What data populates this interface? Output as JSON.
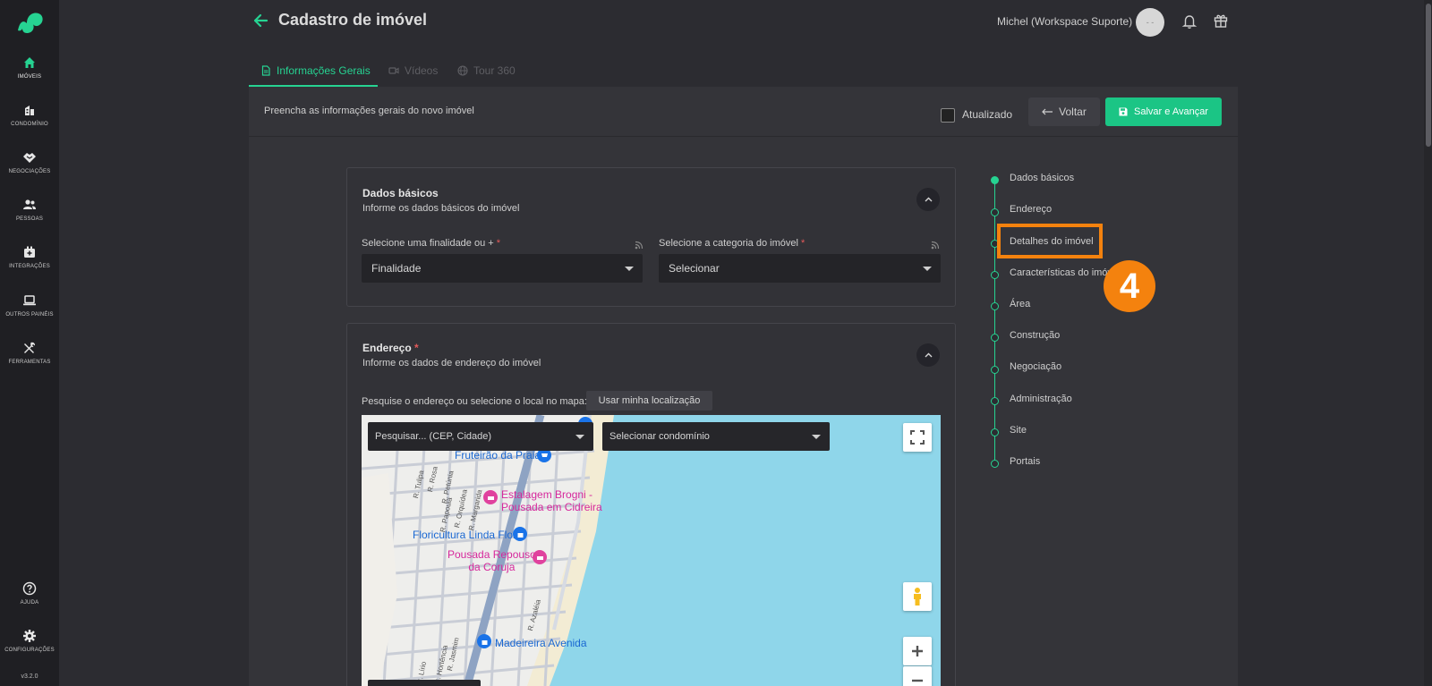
{
  "sidebar": {
    "items": [
      {
        "label": "IMÓVEIS",
        "icon": "home-icon"
      },
      {
        "label": "CONDOMÍNIO",
        "icon": "building-icon"
      },
      {
        "label": "NEGOCIAÇÕES",
        "icon": "handshake-icon"
      },
      {
        "label": "PESSOAS",
        "icon": "people-icon"
      },
      {
        "label": "INTEGRAÇÕES",
        "icon": "integration-icon"
      },
      {
        "label": "OUTROS PAINÉIS",
        "icon": "laptop-icon"
      },
      {
        "label": "FERRAMENTAS",
        "icon": "tools-icon"
      }
    ],
    "bottom": [
      {
        "label": "AJUDA",
        "icon": "help-icon"
      },
      {
        "label": "CONFIGURAÇÕES",
        "icon": "gear-icon"
      }
    ],
    "version": "v3.2.0"
  },
  "header": {
    "title": "Cadastro de imóvel",
    "user": "Michel (Workspace Suporte)",
    "avatar_text": "- -"
  },
  "tabs": [
    {
      "label": "Informações Gerais",
      "state": "active"
    },
    {
      "label": "Vídeos",
      "state": "disabled"
    },
    {
      "label": "Tour 360",
      "state": "disabled"
    }
  ],
  "topbar": {
    "description": "Preencha as informações gerais do novo imóvel",
    "checkbox_label": "Atualizado",
    "back_label": "Voltar",
    "save_label": "Salvar e Avançar"
  },
  "dados_basicos": {
    "title": "Dados básicos",
    "subtitle": "Informe os dados básicos do imóvel",
    "finalidade_label": "Selecione uma finalidade ou +",
    "finalidade_value": "Finalidade",
    "categoria_label": "Selecione a categoria do imóvel",
    "categoria_value": "Selecionar",
    "required_mark": "*"
  },
  "endereco": {
    "title": "Endereço",
    "required_mark": "*",
    "subtitle": "Informe os dados de endereço do imóvel",
    "search_label": "Pesquise o endereço ou selecione o local no mapa:",
    "location_button": "Usar minha localização",
    "map": {
      "search_placeholder": "Pesquisar... (CEP, Cidade)",
      "condominio_placeholder": "Selecionar condomínio",
      "pois": [
        {
          "name": "Fruteirão da Praia",
          "color": "blue"
        },
        {
          "name": "Estalagem Brogni -\nPousada em Cidreira",
          "color": "pink"
        },
        {
          "name": "Floricultura Linda Flor",
          "color": "blue"
        },
        {
          "name": "Pousada Repouso\nda Coruja",
          "color": "pink"
        },
        {
          "name": "Madeireira Avenida",
          "color": "blue"
        }
      ],
      "streets": [
        "R. Tulipa",
        "R. Rosa",
        "R. Petúnia",
        "R. Papoula",
        "R. Orquídea",
        "R. Margarida",
        "R. Azaléia",
        "R. Jasmim",
        "R. Hortência",
        "R. Lírio"
      ]
    }
  },
  "stepper": {
    "steps": [
      "Dados básicos",
      "Endereço",
      "Detalhes do imóvel",
      "Características do imóvel",
      "Área",
      "Construção",
      "Negociação",
      "Administração",
      "Site",
      "Portais"
    ],
    "badge": "4"
  },
  "colors": {
    "accent": "#26d392",
    "highlight": "#f4820e",
    "sea": "#8fd6ea"
  }
}
